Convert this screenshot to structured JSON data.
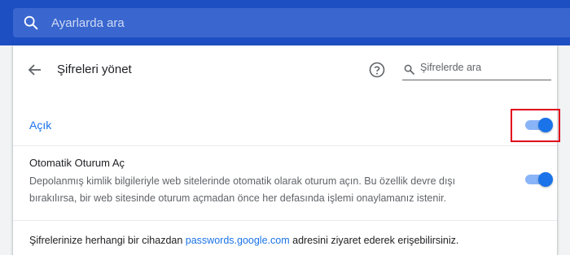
{
  "search": {
    "placeholder": "Ayarlarda ara"
  },
  "page": {
    "title": "Şifreleri yönet",
    "search_placeholder": "Şifrelerde ara"
  },
  "main_toggle": {
    "label": "Açık",
    "checked": true
  },
  "auto_signin": {
    "title": "Otomatik Oturum Aç",
    "description": "Depolanmış kimlik bilgileriyle web sitelerinde otomatik olarak oturum açın. Bu özellik devre dışı bırakılırsa, bir web sitesinde oturum açmadan önce her defasında işlemi onaylamanız istenir.",
    "checked": true
  },
  "access_info": {
    "prefix": "Şifrelerinize herhangi bir cihazdan ",
    "link": "passwords.google.com",
    "suffix": " adresini ziyaret ederek erişebilirsiniz."
  },
  "colors": {
    "header": "#1e4fc2",
    "accent": "#1a73e8",
    "highlight": "#e0001a"
  },
  "icons": [
    "search-icon",
    "back-arrow-icon",
    "help-icon",
    "search-icon"
  ]
}
